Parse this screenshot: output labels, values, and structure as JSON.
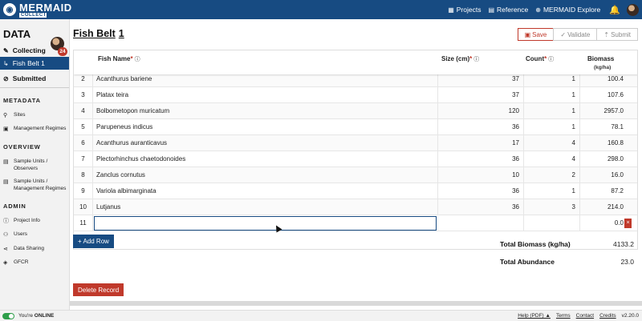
{
  "app": {
    "logo_name": "MERMAID",
    "logo_sub": "COLLECT"
  },
  "topnav": {
    "projects": "Projects",
    "reference": "Reference",
    "explore": "MERMAID Explore"
  },
  "sidebar": {
    "title": "DATA",
    "badge": "24",
    "collecting": "Collecting",
    "active_record": "Fish Belt 1",
    "submitted": "Submitted",
    "metadata_heading": "METADATA",
    "metadata_items": [
      "Sites",
      "Management Regimes"
    ],
    "overview_heading": "OVERVIEW",
    "overview_items": [
      [
        "Sample Units /",
        "Observers"
      ],
      [
        "Sample Units /",
        "Management Regimes"
      ]
    ],
    "admin_heading": "ADMIN",
    "admin_items": [
      "Project Info",
      "Users",
      "Data Sharing",
      "GFCR"
    ]
  },
  "record": {
    "title_word": "Fish Belt",
    "title_num": "1"
  },
  "actions": {
    "save": "Save",
    "validate": "Validate",
    "submit": "Submit"
  },
  "table": {
    "headers": {
      "fish_name": "Fish Name",
      "size": "Size (cm)",
      "count": "Count",
      "biomass": "Biomass",
      "biomass_units": "(kg/ha)",
      "required_mark": "*",
      "info_glyph": "ⓘ"
    },
    "rows": [
      {
        "num": "2",
        "name": "Acanthurus bariene",
        "size": "37",
        "count": "1",
        "biomass": "100.4"
      },
      {
        "num": "3",
        "name": "Platax teira",
        "size": "37",
        "count": "1",
        "biomass": "107.6"
      },
      {
        "num": "4",
        "name": "Bolbometopon muricatum",
        "size": "120",
        "count": "1",
        "biomass": "2957.0"
      },
      {
        "num": "5",
        "name": "Parupeneus indicus",
        "size": "36",
        "count": "1",
        "biomass": "78.1"
      },
      {
        "num": "6",
        "name": "Acanthurus auranticavus",
        "size": "17",
        "count": "4",
        "biomass": "160.8"
      },
      {
        "num": "7",
        "name": "Plectorhinchus chaetodonoides",
        "size": "36",
        "count": "4",
        "biomass": "298.0"
      },
      {
        "num": "8",
        "name": "Zanclus cornutus",
        "size": "10",
        "count": "2",
        "biomass": "16.0"
      },
      {
        "num": "9",
        "name": "Variola albimarginata",
        "size": "36",
        "count": "1",
        "biomass": "87.2"
      },
      {
        "num": "10",
        "name": "Lutjanus",
        "size": "36",
        "count": "3",
        "biomass": "214.0"
      }
    ],
    "edit_row": {
      "num": "11",
      "name": "",
      "size": "",
      "count": "",
      "biomass": "0.0",
      "delete_glyph": "×"
    }
  },
  "add_row_label": "+ Add Row",
  "totals": {
    "biomass_label": "Total Biomass (kg/ha)",
    "biomass_value": "4133.2",
    "abundance_label": "Total Abundance",
    "abundance_value": "23.0"
  },
  "delete_record_label": "Delete Record",
  "footer": {
    "online_prefix": "You're ",
    "online_status": "ONLINE",
    "help": "Help (PDF)",
    "terms": "Terms",
    "contact": "Contact",
    "credits": "Credits",
    "version": "v2.20.0"
  },
  "colors": {
    "brand": "#174b82",
    "danger": "#c0392b",
    "online": "#2e9e4a"
  }
}
